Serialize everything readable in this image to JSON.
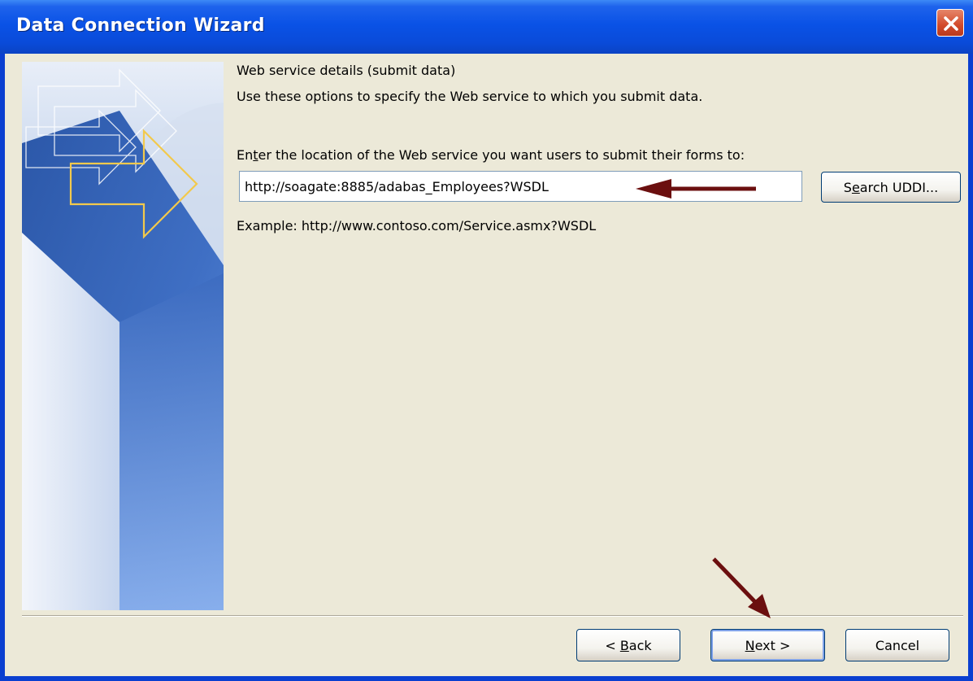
{
  "window": {
    "title": "Data Connection Wizard",
    "close_icon": "close-icon"
  },
  "page": {
    "heading": "Web service details (submit data)",
    "description": "Use these options to specify the Web service to which you submit data.",
    "location_label_pre": "En",
    "location_label_mnemonic": "t",
    "location_label_post": "er the location of the Web service you want users to submit their forms to:",
    "url_value": "http://soagate:8885/adabas_Employees?WSDL",
    "example": "Example: http://www.contoso.com/Service.asmx?WSDL",
    "search_pre": "S",
    "search_mnemonic": "e",
    "search_post": "arch UDDI..."
  },
  "buttons": {
    "back_pre": "< ",
    "back_mnemonic": "B",
    "back_post": "ack",
    "next_mnemonic": "N",
    "next_post": "ext >",
    "cancel": "Cancel"
  },
  "colors": {
    "title_bar": "#0a52e6",
    "dialog_bg": "#ece9d8",
    "annotation_arrow": "#6b0f0f"
  }
}
